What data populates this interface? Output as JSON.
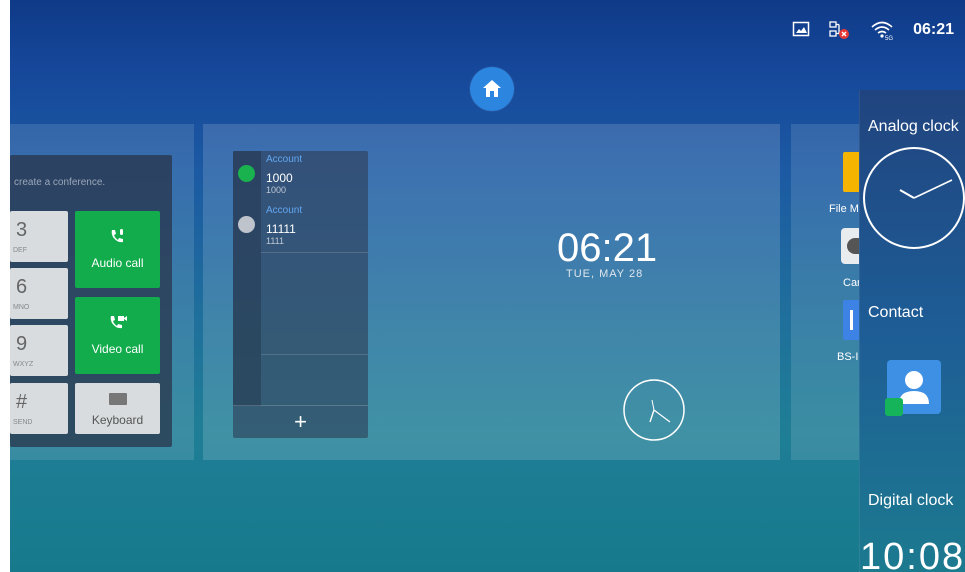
{
  "status_bar": {
    "time": "06:21",
    "icons": [
      "screenshot-icon",
      "network-error-icon",
      "wifi-icon"
    ],
    "wifi_band": "5G"
  },
  "home_button": {
    "icon": "home-icon",
    "color": "#2c86e0"
  },
  "dialer": {
    "hint": "create a conference.",
    "keys": [
      {
        "num": "3",
        "letters": "DEF"
      },
      {
        "num": "6",
        "letters": "MNO"
      },
      {
        "num": "9",
        "letters": "WXYZ"
      },
      {
        "num": "#",
        "letters": "SEND"
      }
    ],
    "audio_call": "Audio call",
    "video_call": "Video call",
    "keyboard": "Keyboard",
    "accent": "#12ac4c"
  },
  "accounts": [
    {
      "title": "Account",
      "number": "1000",
      "sub": "1000",
      "status_color": "#1ab24f"
    },
    {
      "title": "Account",
      "number": "11111",
      "sub": "1111",
      "status_color": "#bfc4cc"
    }
  ],
  "accounts_add": "+",
  "clock": {
    "time": "06:21",
    "date": "TUE, MAY 28"
  },
  "right_apps": [
    {
      "label": "File M",
      "color": "#f4b400"
    },
    {
      "label": "Car",
      "color": "#e9ecef"
    },
    {
      "label": "BS-I",
      "color": "#3d83e6"
    }
  ],
  "widget_drawer": {
    "analog_label": "Analog clock",
    "contact_label": "Contact",
    "digital_label": "Digital clock",
    "digital_preview": "10:08"
  }
}
